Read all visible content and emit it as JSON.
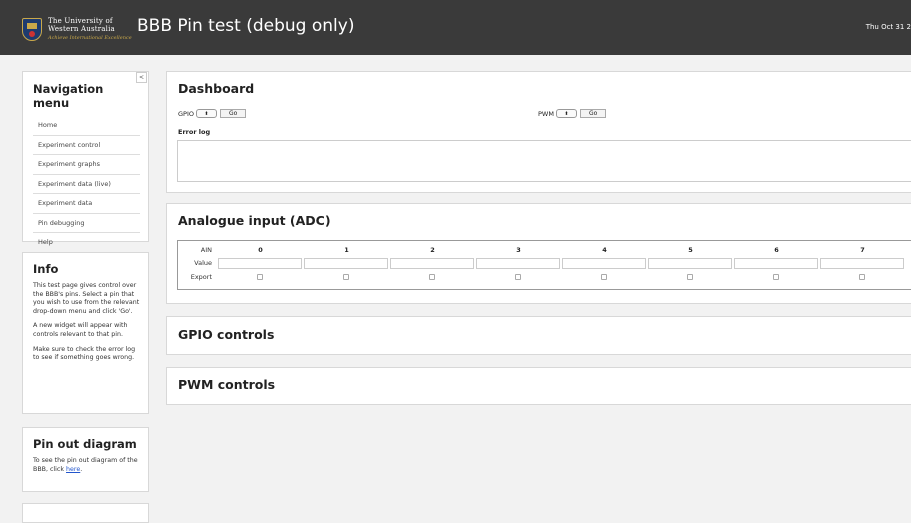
{
  "header": {
    "logo": {
      "line1": "The University of",
      "line2": "Western Australia",
      "line3": "Achieve International Excellence"
    },
    "title": "BBB Pin test (debug only)",
    "datetime": "Thu Oct 31 2"
  },
  "sidebar": {
    "collapse_label": "<",
    "nav": {
      "title": "Navigation menu",
      "items": [
        {
          "label": "Home"
        },
        {
          "label": "Experiment control"
        },
        {
          "label": "Experiment graphs"
        },
        {
          "label": "Experiment data (live)"
        },
        {
          "label": "Experiment data"
        },
        {
          "label": "Pin debugging"
        },
        {
          "label": "Help"
        }
      ]
    },
    "info": {
      "title": "Info",
      "p1": "This test page gives control over the BBB's pins. Select a pin that you wish to use from the relevant drop-down menu and click 'Go'.",
      "p2": "A new widget will appear with controls relevant to that pin.",
      "p3": "Make sure to check the error log to see if something goes wrong."
    },
    "pinout": {
      "title": "Pin out diagram",
      "text": "To see the pin out diagram of the BBB, click ",
      "link": "here",
      "end": "."
    }
  },
  "dashboard": {
    "title": "Dashboard",
    "gpio_label": "GPIO",
    "pwm_label": "PWM",
    "select_arrows": "⬍",
    "go_label": "Go",
    "error_log_label": "Error log"
  },
  "adc": {
    "title": "Analogue input (ADC)",
    "ain_label": "AIN",
    "value_label": "Value",
    "export_label": "Export",
    "channels": [
      "0",
      "1",
      "2",
      "3",
      "4",
      "5",
      "6",
      "7"
    ]
  },
  "gpio": {
    "title": "GPIO controls"
  },
  "pwm": {
    "title": "PWM controls"
  }
}
